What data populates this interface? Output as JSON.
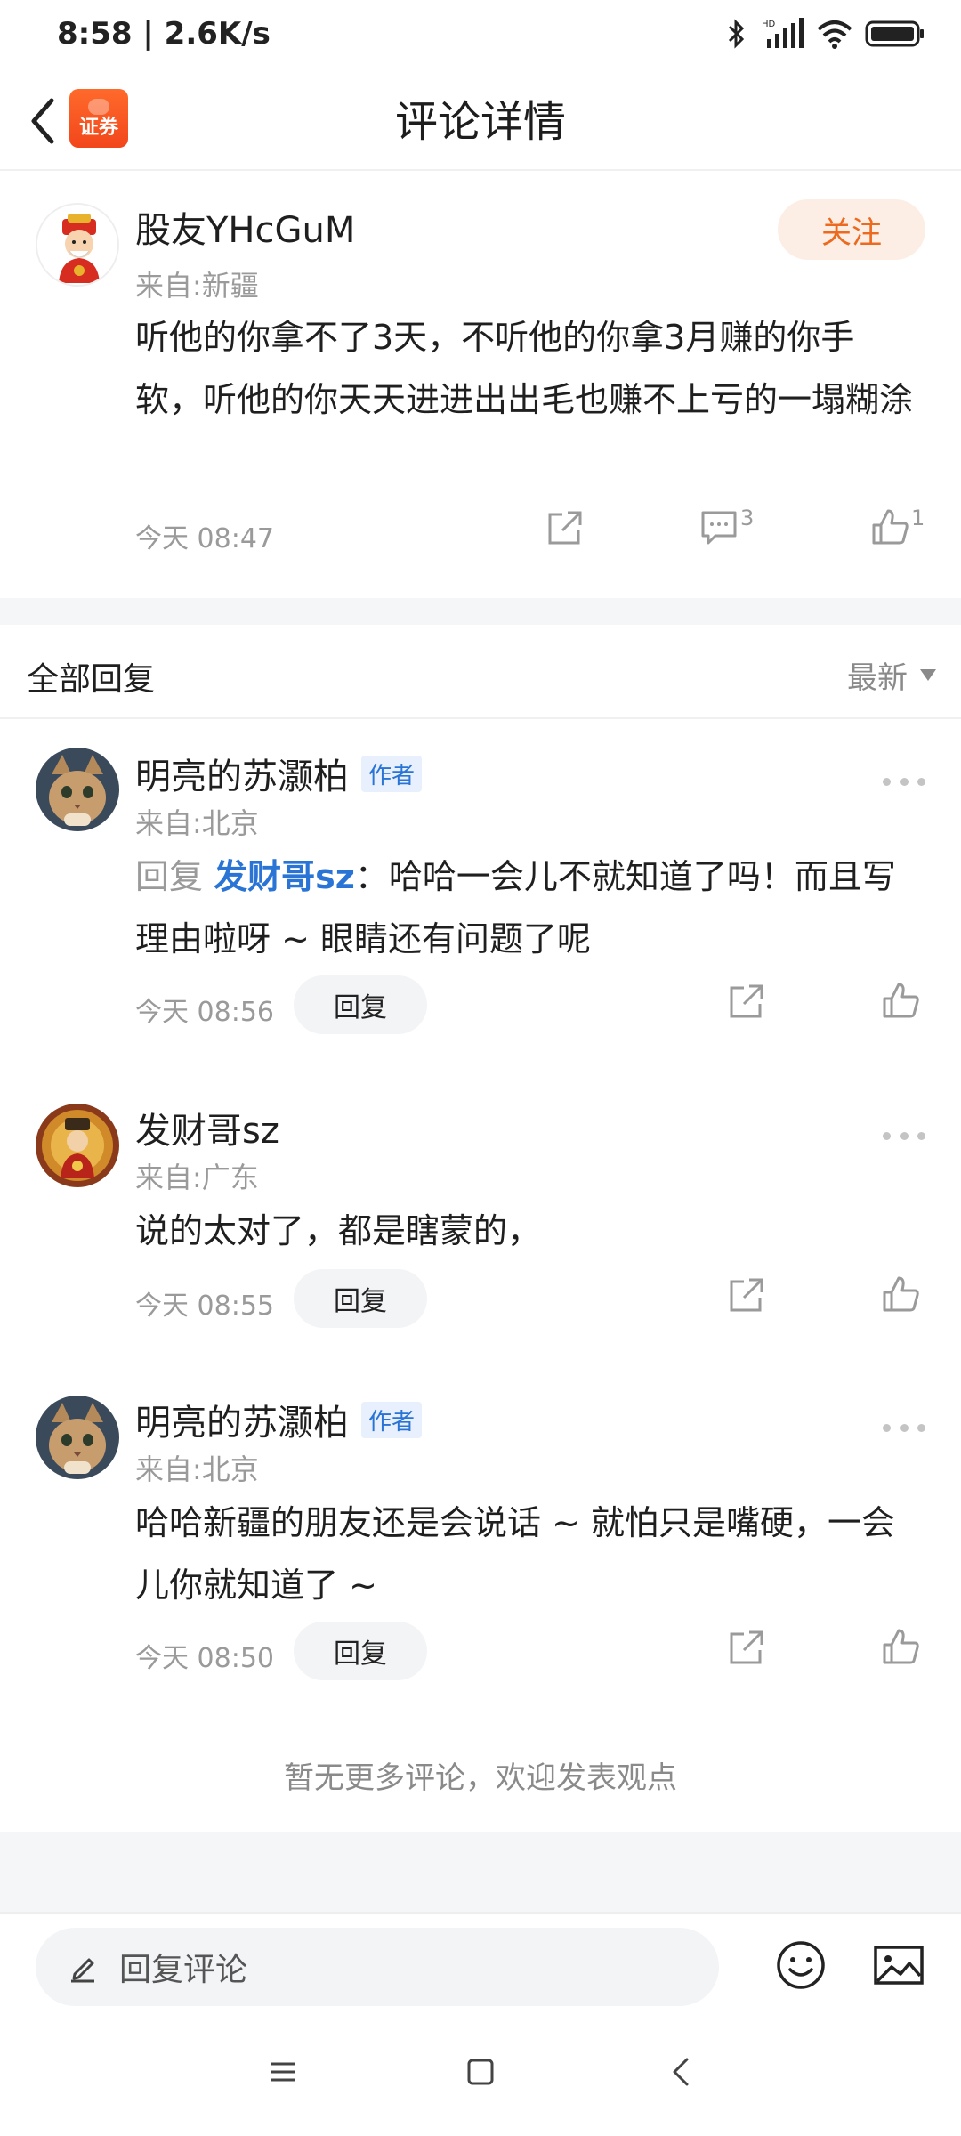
{
  "status_bar": {
    "time": "8:58 | 2.6K/s",
    "icons": [
      "bluetooth-icon",
      "signal-icon",
      "wifi-icon",
      "battery-icon"
    ]
  },
  "header": {
    "title": "评论详情",
    "logo_text": "证券"
  },
  "main_comment": {
    "username": "股友YHcGuM",
    "location": "来自:新疆",
    "follow_label": "关注",
    "text": "听他的你拿不了3天，不听他的你拿3月赚的你手软，听他的你天天进进出出毛也赚不上亏的一塌糊涂",
    "time": "今天 08:47",
    "comment_count": "3",
    "like_count": "1"
  },
  "replies_section": {
    "title": "全部回复",
    "sort_label": "最新"
  },
  "replies": [
    {
      "username": "明亮的苏灏柏",
      "badge": "作者",
      "location": "来自:北京",
      "reply_prefix": "回复",
      "mention": "发财哥sz",
      "text": "：哈哈一会儿不就知道了吗！而且写理由啦呀 ~ 眼睛还有问题了呢",
      "time": "今天 08:56",
      "reply_label": "回复"
    },
    {
      "username": "发财哥sz",
      "location": "来自:广东",
      "text": "说的太对了，都是瞎蒙的，",
      "time": "今天 08:55",
      "reply_label": "回复"
    },
    {
      "username": "明亮的苏灏柏",
      "badge": "作者",
      "location": "来自:北京",
      "text": "哈哈新疆的朋友还是会说话 ~ 就怕只是嘴硬，一会儿你就知道了 ~",
      "time": "今天 08:50",
      "reply_label": "回复"
    }
  ],
  "footer_note": "暂无更多评论，欢迎发表观点",
  "bottom_bar": {
    "input_placeholder": "回复评论"
  },
  "colors": {
    "accent_orange": "#ec6a1f",
    "link_blue": "#2a74d6",
    "muted_gray": "#9a9a9a"
  }
}
